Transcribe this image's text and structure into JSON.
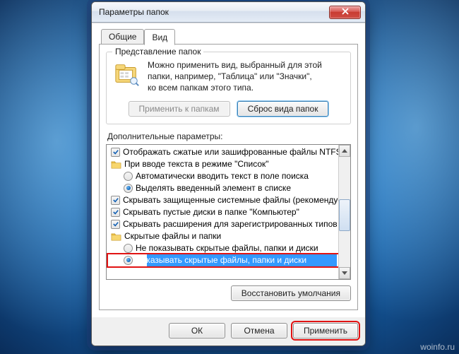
{
  "window": {
    "title": "Параметры папок"
  },
  "tabs": {
    "general": "Общие",
    "view": "Вид"
  },
  "folder_views": {
    "group_title": "Представление папок",
    "desc_l1": "Можно применить вид, выбранный для этой",
    "desc_l2": "папки, например, \"Таблица\" или \"Значки\",",
    "desc_l3": "ко всем папкам этого типа.",
    "apply_btn": "Применить к папкам",
    "reset_btn": "Сброс вида папок"
  },
  "advanced": {
    "label": "Дополнительные параметры:",
    "items": [
      {
        "kind": "check",
        "depth": 0,
        "checked": true,
        "text": "Отображать сжатые или зашифрованные файлы NTFS другим цветом"
      },
      {
        "kind": "folder",
        "depth": 0,
        "text": "При вводе текста в режиме \"Список\""
      },
      {
        "kind": "radio",
        "depth": 1,
        "on": false,
        "text": "Автоматически вводить текст в поле поиска"
      },
      {
        "kind": "radio",
        "depth": 1,
        "on": true,
        "text": "Выделять введенный элемент в списке"
      },
      {
        "kind": "check",
        "depth": 0,
        "checked": true,
        "text": "Скрывать защищенные системные файлы (рекомендуется)"
      },
      {
        "kind": "check",
        "depth": 0,
        "checked": true,
        "text": "Скрывать пустые диски в папке \"Компьютер\""
      },
      {
        "kind": "check",
        "depth": 0,
        "checked": true,
        "text": "Скрывать расширения для зарегистрированных типов файлов"
      },
      {
        "kind": "folder",
        "depth": 0,
        "text": "Скрытые файлы и папки"
      },
      {
        "kind": "radio",
        "depth": 1,
        "on": false,
        "text": "Не показывать скрытые файлы, папки и диски"
      },
      {
        "kind": "radio",
        "depth": 1,
        "on": true,
        "selected": true,
        "highlight": true,
        "text": "Показывать скрытые файлы, папки и диски"
      }
    ],
    "restore_btn": "Восстановить умолчания"
  },
  "buttons": {
    "ok": "ОК",
    "cancel": "Отмена",
    "apply": "Применить"
  },
  "watermark": "woinfo.ru"
}
